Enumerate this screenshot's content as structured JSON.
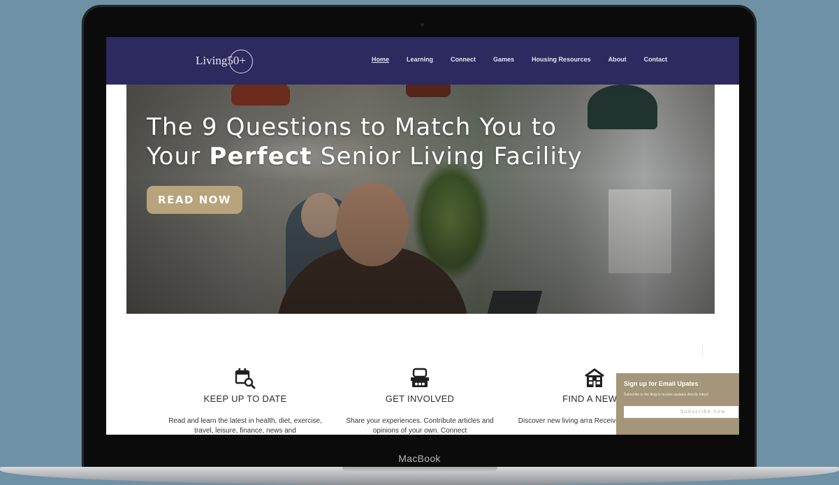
{
  "device": {
    "label": "MacBook"
  },
  "site": {
    "logo_text": "Living50+",
    "nav": [
      {
        "label": "Home",
        "active": true
      },
      {
        "label": "Learning",
        "active": false
      },
      {
        "label": "Connect",
        "active": false
      },
      {
        "label": "Games",
        "active": false
      },
      {
        "label": "Housing Resources",
        "active": false
      },
      {
        "label": "About",
        "active": false
      },
      {
        "label": "Contact",
        "active": false
      }
    ]
  },
  "hero": {
    "title_line1": "The 9 Questions to Match You to",
    "title_line2_pre": "Your ",
    "title_line2_bold": "Perfect",
    "title_line2_post": " Senior Living Facility",
    "cta_label": "READ NOW"
  },
  "features": [
    {
      "icon": "calendar-search-icon",
      "title": "KEEP UP TO DATE",
      "text": "Read and learn the latest in health, diet, exercise, travel, leisure, finance, news and"
    },
    {
      "icon": "chat-group-icon",
      "title": "GET INVOLVED",
      "text": "Share your experiences. Contribute articles and opinions of your own. Connect"
    },
    {
      "icon": "house-icon",
      "title": "FIND A NEW H",
      "text": "Discover new living arra Receive personalized an"
    }
  ],
  "email_popup": {
    "title": "Sign up for Email Upates",
    "text": "Subscribe to the blog to receive updates directly inbox!",
    "button_label": "Subscribe now"
  },
  "colors": {
    "background": "#6e91a6",
    "header": "#2c2a5e",
    "accent": "#b7a47d",
    "popup": "#a4967a"
  }
}
